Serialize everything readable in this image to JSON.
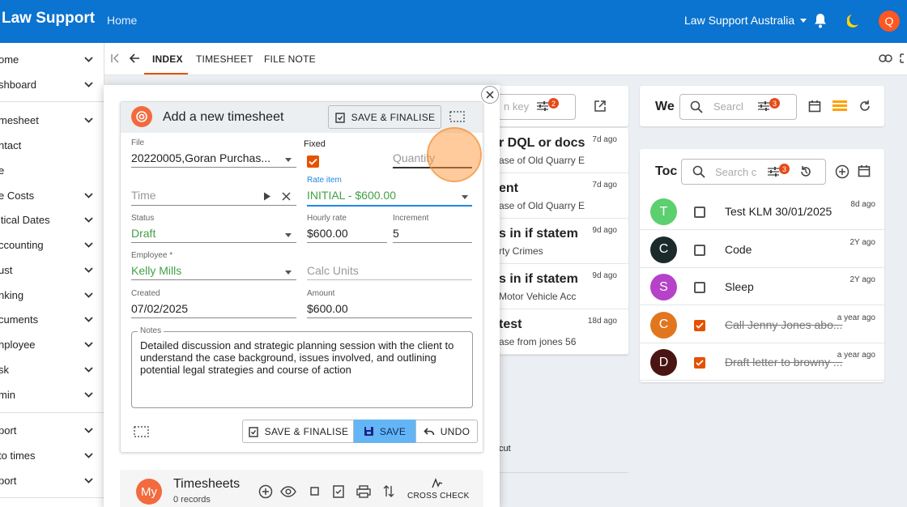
{
  "topbar": {
    "brand": "Law Support",
    "home": "Home",
    "org": "Law Support Australia",
    "avatar": "Q",
    "colors": {
      "bar": "#0b73d0",
      "accent": "#e65100"
    }
  },
  "sidebar": {
    "items": [
      {
        "label": "ome",
        "chev": true
      },
      {
        "label": "shboard",
        "chev": true
      },
      {
        "label": "mesheet",
        "chev": true
      },
      {
        "label": "ntact",
        "chev": false
      },
      {
        "label": "e",
        "chev": false
      },
      {
        "label": "e Costs",
        "chev": true
      },
      {
        "label": "itical Dates",
        "chev": true
      },
      {
        "label": "ccounting",
        "chev": true
      },
      {
        "label": "ust",
        "chev": true
      },
      {
        "label": "nking",
        "chev": true
      },
      {
        "label": "cuments",
        "chev": true
      },
      {
        "label": "nployee",
        "chev": true
      },
      {
        "label": "sk",
        "chev": true
      },
      {
        "label": "min",
        "chev": true
      },
      {
        "label": "port",
        "chev": true
      },
      {
        "label": "to times",
        "chev": true
      },
      {
        "label": "port",
        "chev": true
      }
    ]
  },
  "tabs": {
    "index": "INDEX",
    "timesheet": "TIMESHEET",
    "filenote": "FILE NOTE"
  },
  "mid": {
    "search_placeholder": "n key",
    "badge": "2",
    "rows": [
      {
        "title": "r DQL or docs",
        "sub": "ase of Old Quarry E",
        "ago": "7d ago"
      },
      {
        "title": "ent",
        "sub": "ase of Old Quarry E",
        "ago": "7d ago"
      },
      {
        "title": "s in if statem",
        "sub": "rty Crimes",
        "ago": "9d ago"
      },
      {
        "title": "s in if statem",
        "sub": "Motor Vehicle Acc",
        "ago": "9d ago"
      },
      {
        "title": "test",
        "sub": "ase from jones 56",
        "ago": "18d ago"
      }
    ],
    "footer_text": "cut"
  },
  "we": {
    "title": "We",
    "search_placeholder": "Searcl",
    "badge": "3"
  },
  "todo": {
    "title": "Toc",
    "search_placeholder": "Search c",
    "badge": "3",
    "rows": [
      {
        "initial": "T",
        "color": "#5ccf6f",
        "text": "Test KLM 30/01/2025",
        "ago": "8d ago",
        "done": false
      },
      {
        "initial": "C",
        "color": "#1b2a2a",
        "text": "Code",
        "ago": "2Y ago",
        "done": false
      },
      {
        "initial": "S",
        "color": "#b542c9",
        "text": "Sleep",
        "ago": "2Y ago",
        "done": false
      },
      {
        "initial": "C",
        "color": "#e2761e",
        "text": "Call Jenny Jones abo...",
        "ago": "a year ago",
        "done": true
      },
      {
        "initial": "D",
        "color": "#4a1412",
        "text": "Draft letter to browny ...",
        "ago": "a year ago",
        "done": true
      }
    ]
  },
  "form": {
    "title": "Add a new timesheet",
    "save_finalise": "SAVE & FINALISE",
    "file": {
      "label": "File",
      "value": "20220005,Goran Purchas..."
    },
    "fixed": {
      "label": "Fixed",
      "checked": true
    },
    "quantity": {
      "placeholder": "Quantity"
    },
    "time": {
      "placeholder": "Time"
    },
    "rate_item": {
      "label": "Rate item",
      "value": "INITIAL - $600.00"
    },
    "status": {
      "label": "Status",
      "value": "Draft"
    },
    "hourly_rate": {
      "label": "Hourly rate",
      "value": "$600.00"
    },
    "increment": {
      "label": "Increment",
      "value": "5"
    },
    "employee": {
      "label": "Employee *",
      "value": "Kelly Mills"
    },
    "calc_units": {
      "placeholder": "Calc Units"
    },
    "created": {
      "label": "Created",
      "value": "07/02/2025"
    },
    "amount": {
      "label": "Amount",
      "value": "$600.00"
    },
    "notes": {
      "label": "Notes",
      "value": "Detailed discussion and strategic planning session with the client to understand the case background, issues involved, and outlining potential legal strategies and course of action"
    },
    "buttons": {
      "save_finalise": "SAVE & FINALISE",
      "save": "SAVE",
      "undo": "UNDO"
    }
  },
  "timesheets": {
    "avatar": "My",
    "title": "Timesheets",
    "count": "0 records",
    "cross_check": "CROSS CHECK"
  }
}
